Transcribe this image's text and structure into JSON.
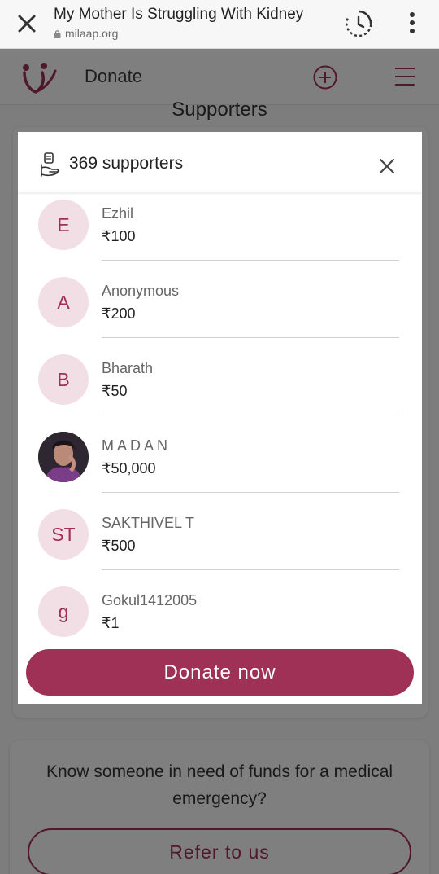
{
  "browser": {
    "title": "My Mother Is Struggling With Kidney",
    "url": "milaap.org"
  },
  "site": {
    "nav_label": "Donate",
    "section_heading": "Supporters",
    "refer_text": "Know someone in need of funds for a medical emergency?",
    "refer_button": "Refer to us"
  },
  "modal": {
    "count_label": "369 supporters",
    "donate_button": "Donate now",
    "supporters": [
      {
        "initial": "E",
        "name": "Ezhil",
        "amount": "₹100"
      },
      {
        "initial": "A",
        "name": "Anonymous",
        "amount": "₹200"
      },
      {
        "initial": "B",
        "name": "Bharath",
        "amount": "₹50"
      },
      {
        "initial": "",
        "name": "M A D A N",
        "amount": "₹50,000",
        "photo": true
      },
      {
        "initial": "ST",
        "name": "SAKTHIVEL T",
        "amount": "₹500"
      },
      {
        "initial": "g",
        "name": "Gokul1412005",
        "amount": "₹1"
      }
    ]
  },
  "colors": {
    "brand": "#9f3056",
    "avatar_bg": "#f2dfe5"
  }
}
